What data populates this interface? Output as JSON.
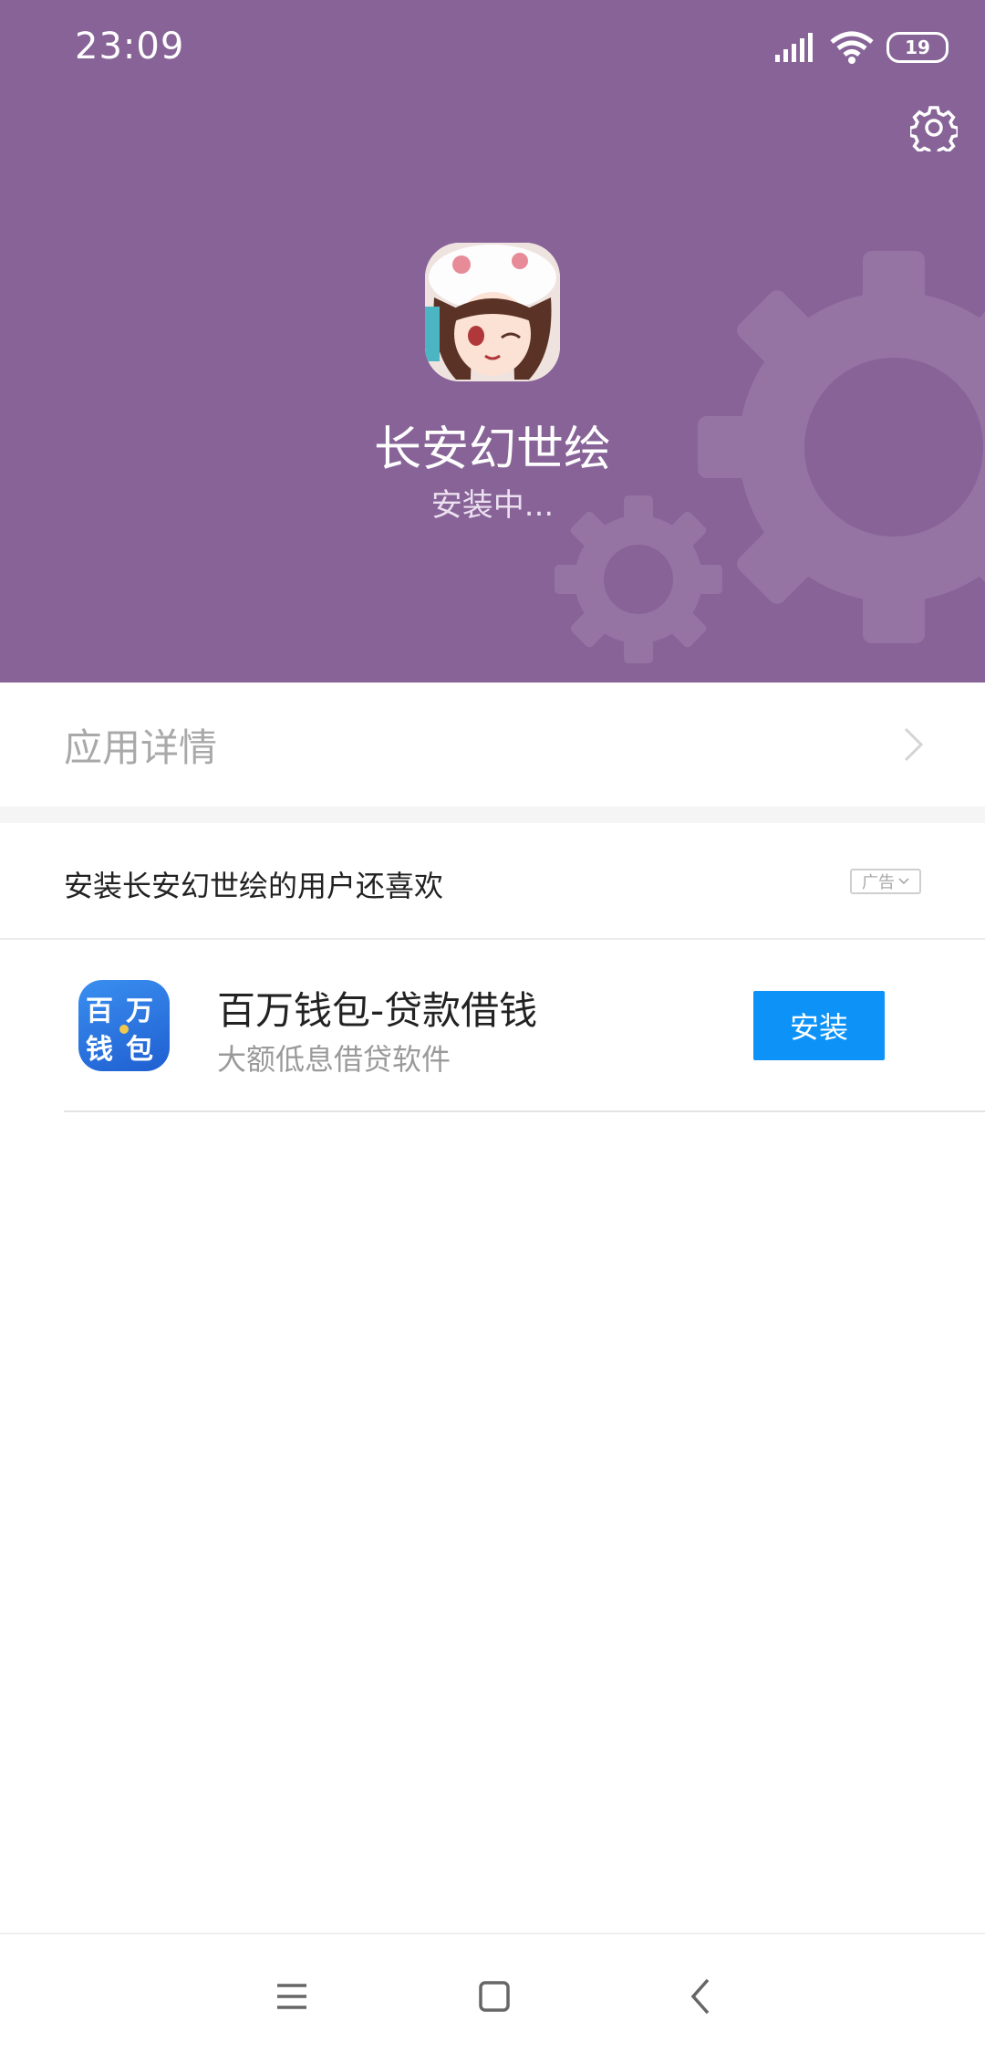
{
  "status_bar": {
    "time": "23:09",
    "battery": "19"
  },
  "header": {
    "app_name": "长安幻世绘",
    "install_status": "安装中...",
    "icons": [
      "settings-gear-icon",
      "app-icon"
    ],
    "background_color": "#876397"
  },
  "details": {
    "label": "应用详情"
  },
  "recommendations": {
    "title": "安装长安幻世绘的用户还喜欢",
    "ad_label": "广告",
    "items": [
      {
        "title": "百万钱包-贷款借钱",
        "subtitle": "大额低息借贷软件",
        "button": "安装",
        "icon_text": [
          "百",
          "万",
          "钱",
          "包"
        ]
      }
    ]
  },
  "navbar": {
    "icons": [
      "menu-icon",
      "home-icon",
      "back-icon"
    ]
  },
  "colors": {
    "accent": "#0d93f7",
    "header": "#876397"
  }
}
